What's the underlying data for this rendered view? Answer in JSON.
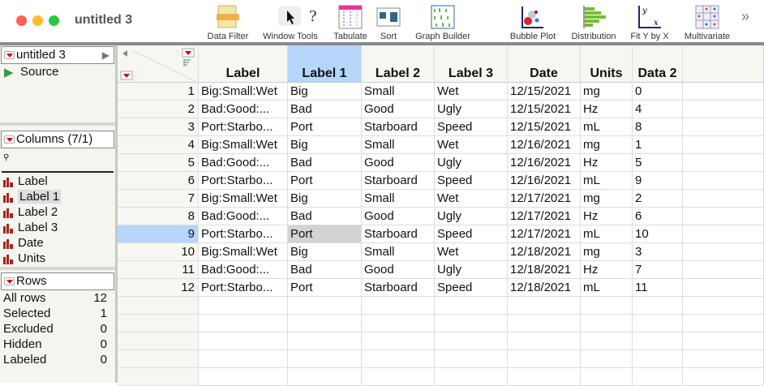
{
  "window": {
    "title": "untitled 3"
  },
  "toolbar": [
    {
      "label": "Data Filter",
      "icon": "data-filter-icon"
    },
    {
      "label": "Window Tools",
      "icon": "pointer-icon"
    },
    {
      "label": "Tabulate",
      "icon": "tabulate-icon"
    },
    {
      "label": "Sort",
      "icon": "sort-icon"
    },
    {
      "label": "Graph Builder",
      "icon": "graph-builder-icon"
    },
    {
      "label": "Bubble Plot",
      "icon": "bubble-plot-icon"
    },
    {
      "label": "Distribution",
      "icon": "distribution-icon"
    },
    {
      "label": "Fit Y by X",
      "icon": "fit-y-by-x-icon"
    },
    {
      "label": "Multivariate",
      "icon": "multivariate-icon"
    }
  ],
  "table_panel": {
    "name": "untitled 3",
    "source": "Source"
  },
  "columns_panel": {
    "title": "Columns (7/1)",
    "items": [
      "Label",
      "Label 1",
      "Label 2",
      "Label 3",
      "Date",
      "Units"
    ],
    "selected": "Label 1"
  },
  "rows_panel": {
    "title": "Rows",
    "stats": [
      {
        "label": "All rows",
        "value": "12"
      },
      {
        "label": "Selected",
        "value": "1"
      },
      {
        "label": "Excluded",
        "value": "0"
      },
      {
        "label": "Hidden",
        "value": "0"
      },
      {
        "label": "Labeled",
        "value": "0"
      }
    ]
  },
  "table": {
    "columns": [
      "Label",
      "Label 1",
      "Label 2",
      "Label 3",
      "Date",
      "Units",
      "Data 2"
    ],
    "rows": [
      [
        "1",
        "Big:Small:Wet",
        "Big",
        "Small",
        "Wet",
        "12/15/2021",
        "mg",
        "0"
      ],
      [
        "2",
        "Bad:Good:...",
        "Bad",
        "Good",
        "Ugly",
        "12/15/2021",
        "Hz",
        "4"
      ],
      [
        "3",
        "Port:Starbo...",
        "Port",
        "Starboard",
        "Speed",
        "12/15/2021",
        "mL",
        "8"
      ],
      [
        "4",
        "Big:Small:Wet",
        "Big",
        "Small",
        "Wet",
        "12/16/2021",
        "mg",
        "1"
      ],
      [
        "5",
        "Bad:Good:...",
        "Bad",
        "Good",
        "Ugly",
        "12/16/2021",
        "Hz",
        "5"
      ],
      [
        "6",
        "Port:Starbo...",
        "Port",
        "Starboard",
        "Speed",
        "12/16/2021",
        "mL",
        "9"
      ],
      [
        "7",
        "Big:Small:Wet",
        "Big",
        "Small",
        "Wet",
        "12/17/2021",
        "mg",
        "2"
      ],
      [
        "8",
        "Bad:Good:...",
        "Bad",
        "Good",
        "Ugly",
        "12/17/2021",
        "Hz",
        "6"
      ],
      [
        "9",
        "Port:Starbo...",
        "Port",
        "Starboard",
        "Speed",
        "12/17/2021",
        "mL",
        "10"
      ],
      [
        "10",
        "Big:Small:Wet",
        "Big",
        "Small",
        "Wet",
        "12/18/2021",
        "mg",
        "3"
      ],
      [
        "11",
        "Bad:Good:...",
        "Bad",
        "Good",
        "Ugly",
        "12/18/2021",
        "Hz",
        "7"
      ],
      [
        "12",
        "Port:Starbo...",
        "Port",
        "Starboard",
        "Speed",
        "12/18/2021",
        "mL",
        "11"
      ]
    ],
    "selected_row": "9",
    "selected_column": "Label 1"
  },
  "colors": {
    "selection": "#b5d5fb",
    "cell_selected": "#d3d3d3"
  }
}
